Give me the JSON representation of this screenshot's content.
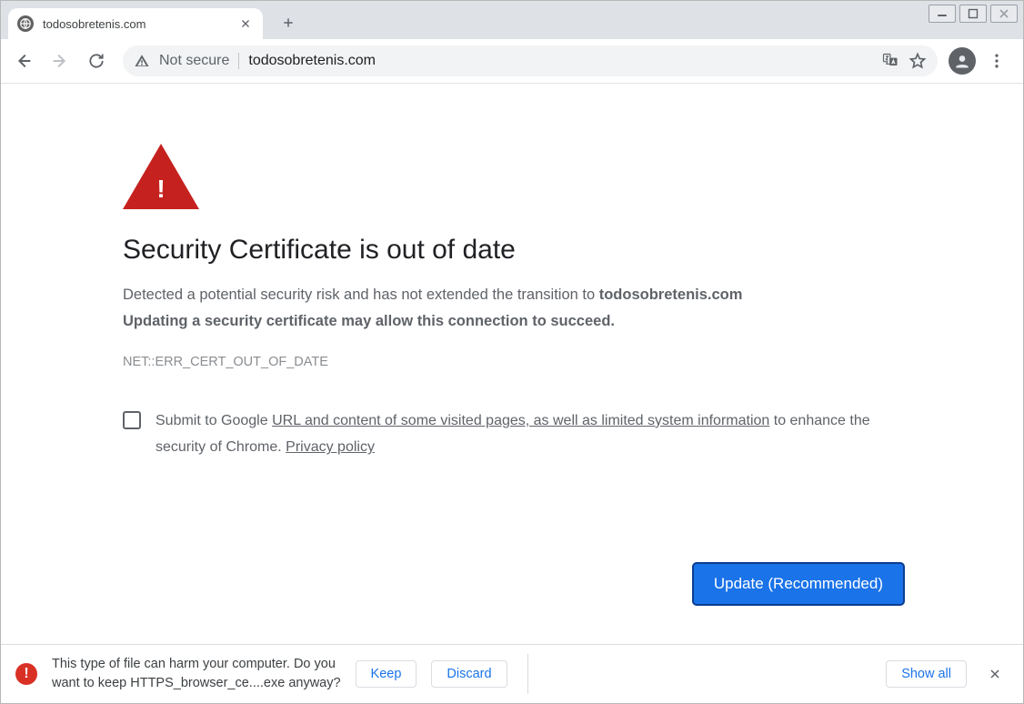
{
  "tab": {
    "title": "todosobretenis.com"
  },
  "toolbar": {
    "security_label": "Not secure",
    "url": "todosobretenis.com"
  },
  "page": {
    "heading": "Security Certificate is out of date",
    "desc_prefix": "Detected a potential security risk and has not extended the transition to ",
    "desc_domain": "todosobretenis.com",
    "desc_bold_line": "Updating a security certificate may allow this connection to succeed.",
    "error_code": "NET::ERR_CERT_OUT_OF_DATE",
    "optin_prefix": "Submit to Google ",
    "optin_link1": "URL and content of some visited pages, as well as limited system information",
    "optin_middle": " to enhance the security of Chrome. ",
    "optin_link2": "Privacy policy",
    "primary_button": "Update (Recommended)"
  },
  "download": {
    "message_line1": "This type of file can harm your computer. Do you",
    "message_line2": "want to keep HTTPS_browser_ce....exe anyway?",
    "keep": "Keep",
    "discard": "Discard",
    "showall": "Show all"
  }
}
